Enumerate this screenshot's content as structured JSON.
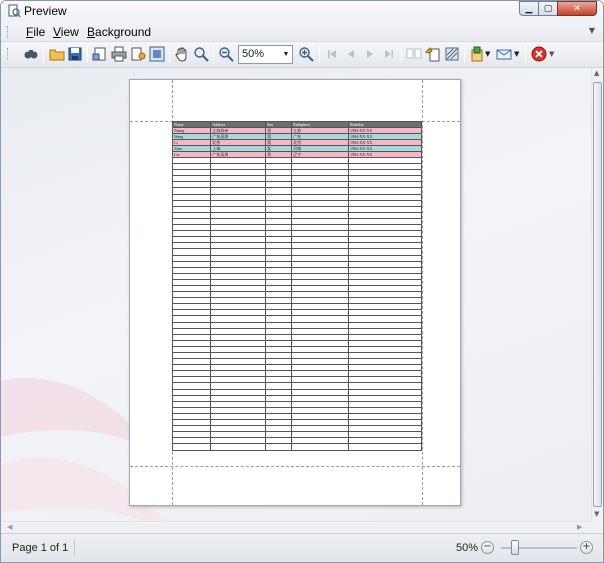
{
  "window": {
    "title": "Preview",
    "icon": "print-preview-icon"
  },
  "menu": {
    "items": [
      "File",
      "View",
      "Background"
    ]
  },
  "toolbar": {
    "zoom_value": "50%",
    "buttons": [
      "find-icon",
      "open-icon",
      "save-icon",
      "page-setup-icon",
      "print-icon",
      "print-options-icon",
      "scale-icon",
      "hand-tool-icon",
      "magnifier-icon",
      "zoom-out-icon",
      "zoom-in-icon",
      "first-page-icon",
      "prev-page-icon",
      "next-page-icon",
      "last-page-icon",
      "multi-page-icon",
      "watermark-icon",
      "background-icon",
      "export-icon",
      "email-icon",
      "close-preview-icon"
    ]
  },
  "report": {
    "headers": [
      "Name",
      "Address",
      "Sex",
      "Birthplace",
      "Birthday"
    ],
    "rows": [
      [
        "Zhang",
        "江苏苏州",
        "男",
        "江苏",
        "1983-XX-XX"
      ],
      [
        "Wang",
        "广东深圳",
        "男",
        "广东",
        "1984-XX-XX"
      ],
      [
        "Li",
        "北京",
        "男",
        "北京",
        "1984-XX-XX"
      ],
      [
        "Zhao",
        "上海",
        "女",
        "河南",
        "1984-XX-XX"
      ],
      [
        "Liu",
        "广东深圳",
        "男",
        "辽宁",
        "1983-XX-XX"
      ]
    ],
    "empty_row_count": 48
  },
  "status": {
    "page_text": "Page 1 of 1",
    "zoom_text": "50%"
  },
  "colors": {
    "header_bg": "#6e6e6e",
    "row_pink": "#f7b8c5",
    "row_teal": "#a9d8dc",
    "page_border": "#9ba8bd"
  }
}
